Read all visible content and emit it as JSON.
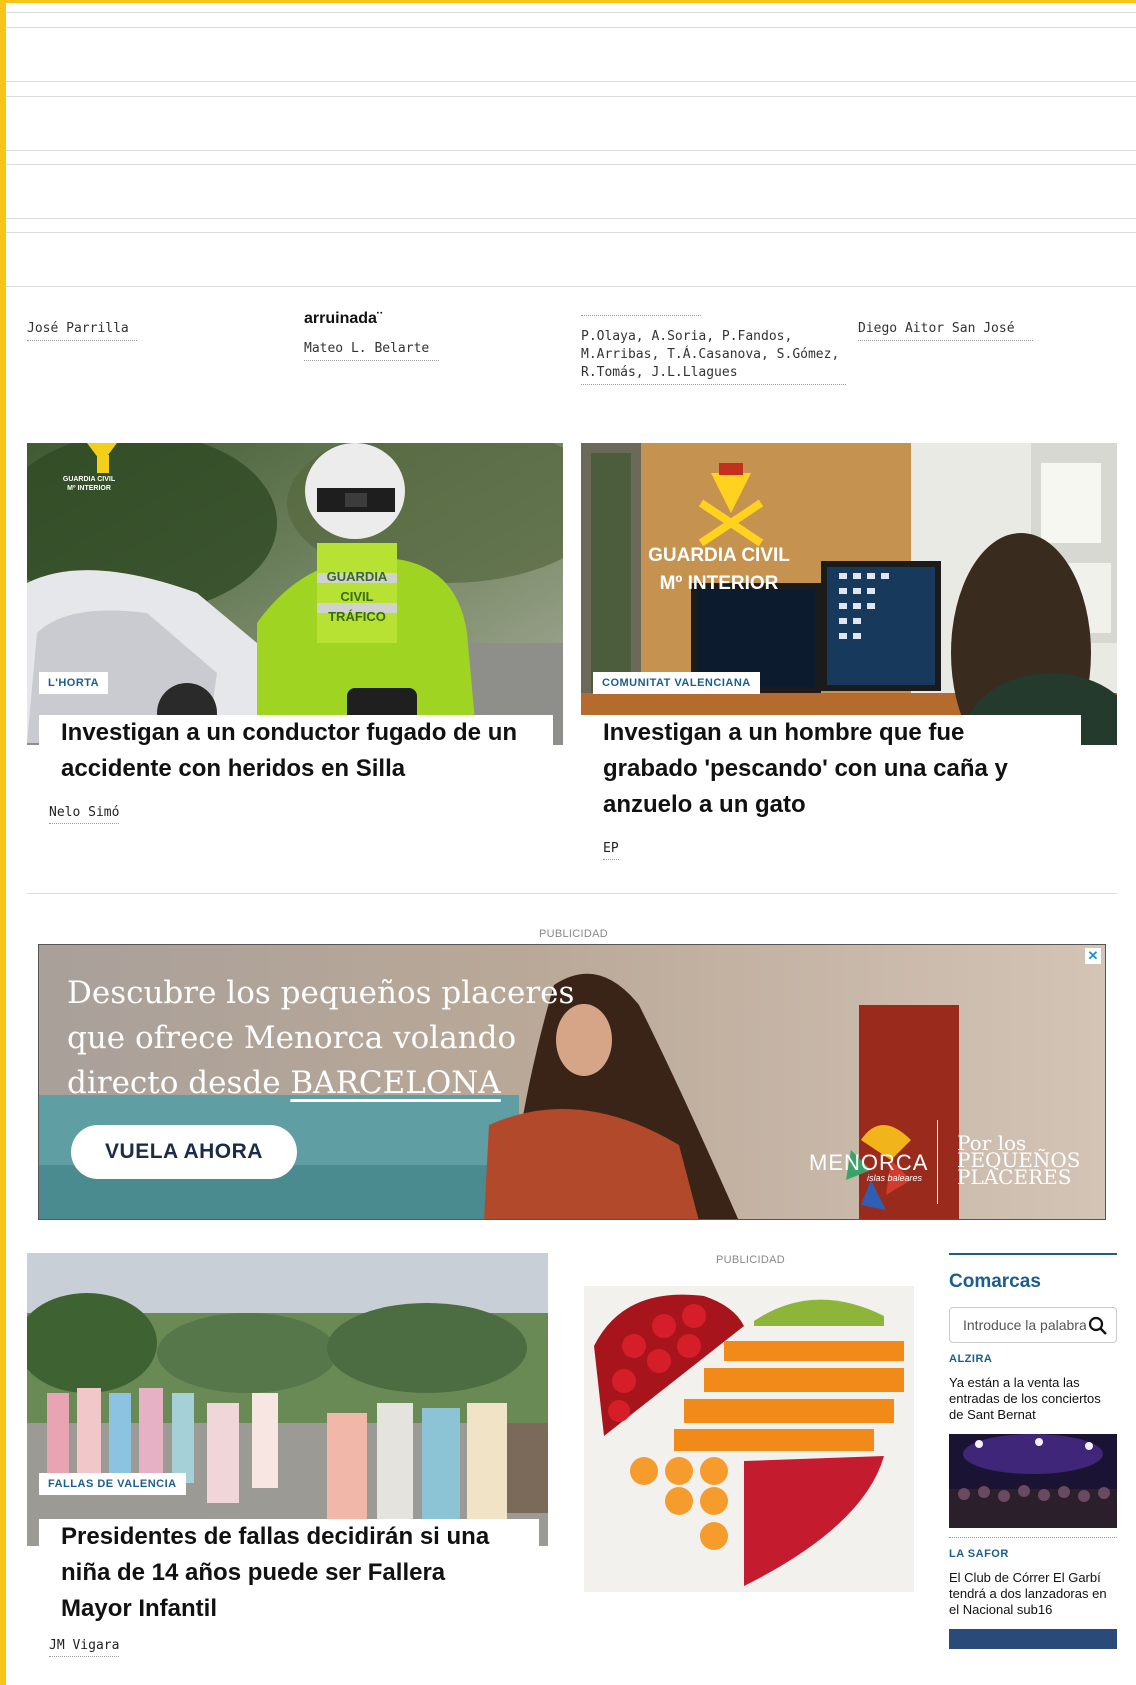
{
  "top_row": {
    "cut_title": "arruinada¨",
    "bylines": [
      "José Parrilla",
      "Mateo L. Belarte",
      "P.Olaya, A.Soria, P.Fandos, M.Arribas, T.Á.Casanova, S.Gómez, R.Tomás, J.L.Llagues",
      "Diego Aitor San José"
    ]
  },
  "cards": [
    {
      "tag": "L'HORTA",
      "headline": "Investigan a un conductor fugado de un accidente con heridos en Silla",
      "author": "Nelo Simó",
      "image_text": "GUARDIA CIVIL Mº INTERIOR",
      "vest_text": "GUARDIA CIVIL TRÁFICO"
    },
    {
      "tag": "COMUNITAT VALENCIANA",
      "headline": "Investigan a un hombre que fue grabado 'pescando' con una caña y anzuelo a un gato",
      "author": "EP",
      "image_text_1": "GUARDIA CIVIL",
      "image_text_2": "Mº INTERIOR"
    },
    {
      "tag": "FALLAS DE VALENCIA",
      "headline": "Presidentes de fallas decidirán si una niña de 14 años puede ser Fallera Mayor Infantil",
      "author": "JM Vigara"
    }
  ],
  "ads": {
    "label": "PUBLICIDAD",
    "banner": {
      "line1": "Descubre los pequeños placeres",
      "line2": "que ofrece Menorca volando",
      "line3_prefix": "directo desde ",
      "line3_highlight": "BARCELONA",
      "cta": "VUELA AHORA",
      "brand": "MENORCA",
      "brand_sub": "islas baleares",
      "slogan_1": "Por los",
      "slogan_2": "PEQUEÑOS",
      "slogan_3": "PLACERES",
      "close": "✕"
    },
    "side_label": "PUBLICIDAD"
  },
  "comarcas": {
    "title": "Comarcas",
    "search_placeholder": "Introduce la palabra",
    "items": [
      {
        "place": "ALZIRA",
        "text": "Ya están a la venta las entradas de los conciertos de Sant Bernat"
      },
      {
        "place": "LA SAFOR",
        "text": "El Club de Córrer El Garbí tendrá a dos lanzadoras en el Nacional sub16"
      }
    ]
  },
  "colors": {
    "accent": "#1b5e8c",
    "frame": "#f5c518"
  }
}
